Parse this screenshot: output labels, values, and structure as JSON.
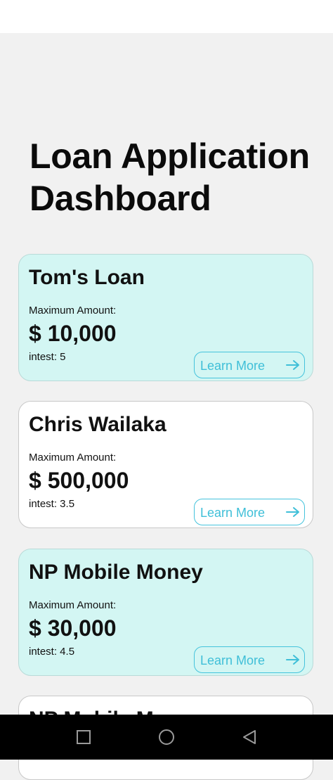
{
  "page": {
    "title": "Loan Application Dashboard"
  },
  "colors": {
    "background": "#f1f1f1",
    "card_teal": "#d3f6f3",
    "card_white": "#ffffff",
    "accent": "#3fbfd8"
  },
  "loans": [
    {
      "name": "Tom's Loan",
      "max_label": "Maximum Amount:",
      "amount": "$ 10,000",
      "interest": "intest: 5",
      "button_label": "Learn More",
      "button_icon": "arrow-right-icon"
    },
    {
      "name": "Chris Wailaka",
      "max_label": "Maximum Amount:",
      "amount": "$ 500,000",
      "interest": "intest: 3.5",
      "button_label": "Learn More",
      "button_icon": "arrow-right-icon"
    },
    {
      "name": "NP Mobile Money",
      "max_label": "Maximum Amount:",
      "amount": "$ 30,000",
      "interest": "intest: 4.5",
      "button_label": "Learn More",
      "button_icon": "arrow-right-icon"
    },
    {
      "name": "NP Mobile Money"
    }
  ],
  "system_nav": {
    "icons": [
      "recents-square-icon",
      "home-circle-icon",
      "back-triangle-icon"
    ]
  }
}
